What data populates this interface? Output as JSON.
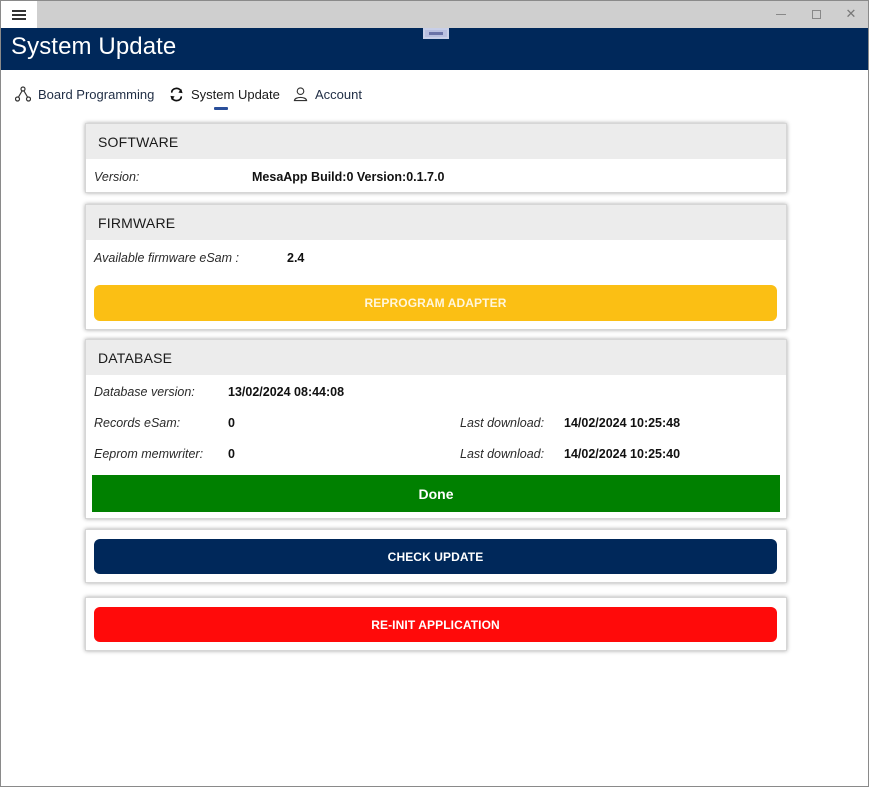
{
  "app": {
    "title": "System Update",
    "window_controls": {
      "minimize": "–",
      "maximize": "☐",
      "close": "✕"
    }
  },
  "tabs": [
    {
      "label": "Board Programming",
      "icon": "nodes-icon",
      "active": false
    },
    {
      "label": "System Update",
      "icon": "sync-icon",
      "active": true
    },
    {
      "label": "Account",
      "icon": "user-icon",
      "active": false
    }
  ],
  "software": {
    "header": "SOFTWARE",
    "version_label": "Version:",
    "version_value": "MesaApp Build:0 Version:0.1.7.0"
  },
  "firmware": {
    "header": "FIRMWARE",
    "available_label": "Available firmware eSam :",
    "available_value": "2.4",
    "reprogram_button": "REPROGRAM ADAPTER"
  },
  "database": {
    "header": "DATABASE",
    "version_label": "Database version:",
    "version_value": "13/02/2024 08:44:08",
    "records_label": "Records eSam:",
    "records_value": "0",
    "records_last_label": "Last download:",
    "records_last_value": "14/02/2024 10:25:48",
    "eeprom_label": "Eeprom memwriter:",
    "eeprom_value": "0",
    "eeprom_last_label": "Last download:",
    "eeprom_last_value": "14/02/2024 10:25:40",
    "status": "Done"
  },
  "actions": {
    "check_update": "CHECK UPDATE",
    "reinit": "RE-INIT APPLICATION"
  },
  "colors": {
    "header_bg": "#00285a",
    "reprogram": "#fbbf14",
    "done": "#008000",
    "check_update": "#00285a",
    "reinit": "#ff0a0a"
  }
}
